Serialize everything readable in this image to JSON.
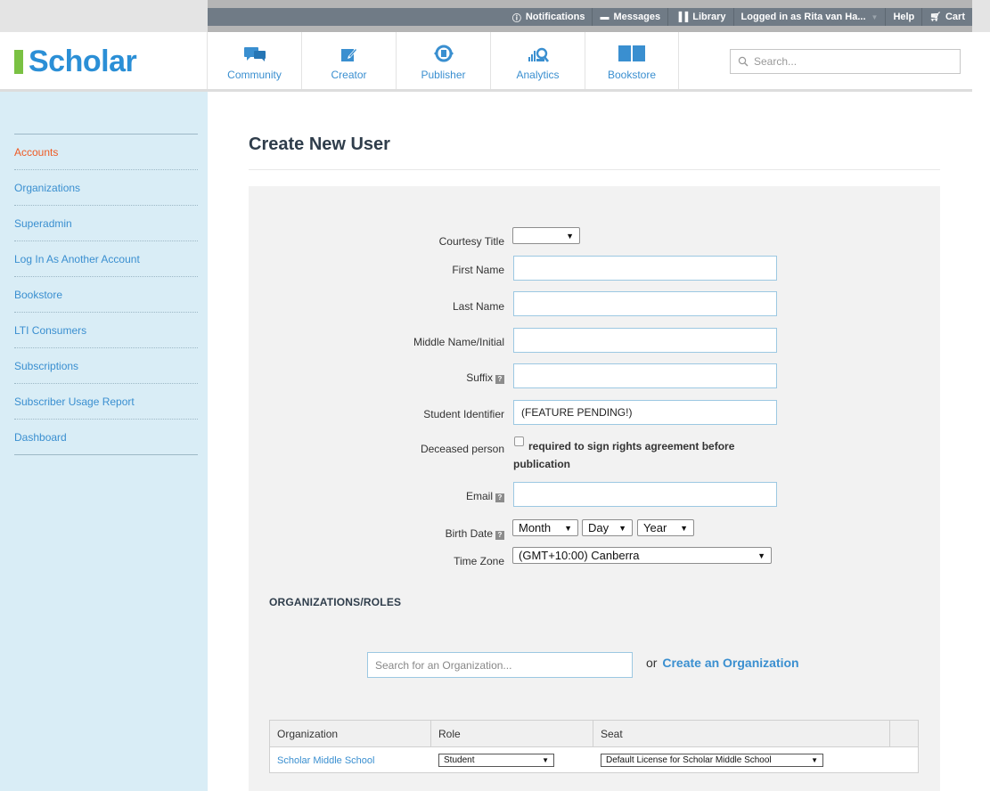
{
  "topnav": {
    "notifications": "Notifications",
    "messages": "Messages",
    "library": "Library",
    "user": "Logged in as Rita van Ha...",
    "help": "Help",
    "cart": "Cart"
  },
  "brand": {
    "name": "Scholar",
    "accent": "#7ac143",
    "color": "#2b8fd6"
  },
  "mainnav": {
    "community": "Community",
    "creator": "Creator",
    "publisher": "Publisher",
    "analytics": "Analytics",
    "bookstore": "Bookstore"
  },
  "search": {
    "placeholder": "Search..."
  },
  "sidebar": {
    "items": [
      "Accounts",
      "Organizations",
      "Superadmin",
      "Log In As Another Account",
      "Bookstore",
      "LTI Consumers",
      "Subscriptions",
      "Subscriber Usage Report",
      "Dashboard"
    ]
  },
  "page": {
    "title": "Create New User"
  },
  "form": {
    "courtesy_title_label": "Courtesy Title",
    "courtesy_title_value": "",
    "first_name_label": "First Name",
    "first_name_value": "",
    "last_name_label": "Last Name",
    "last_name_value": "",
    "middle_name_label": "Middle Name/Initial",
    "middle_name_value": "",
    "suffix_label": "Suffix",
    "suffix_value": "",
    "student_id_label": "Student Identifier",
    "student_id_value": "(FEATURE PENDING!)",
    "deceased_label": "Deceased person",
    "deceased_text": "required to sign rights agreement before publication",
    "email_label": "Email",
    "email_value": "",
    "birth_date_label": "Birth Date",
    "month": "Month",
    "day": "Day",
    "year": "Year",
    "timezone_label": "Time Zone",
    "timezone_value": "(GMT+10:00) Canberra"
  },
  "orgs": {
    "heading": "ORGANIZATIONS/ROLES",
    "search_placeholder": "Search for an Organization...",
    "or_text": "or",
    "create_link": "Create an Organization",
    "columns": [
      "Organization",
      "Role",
      "Seat"
    ],
    "rows": [
      {
        "organization": "Scholar Middle School",
        "role": "Student",
        "seat": "Default License for Scholar Middle School"
      }
    ]
  }
}
